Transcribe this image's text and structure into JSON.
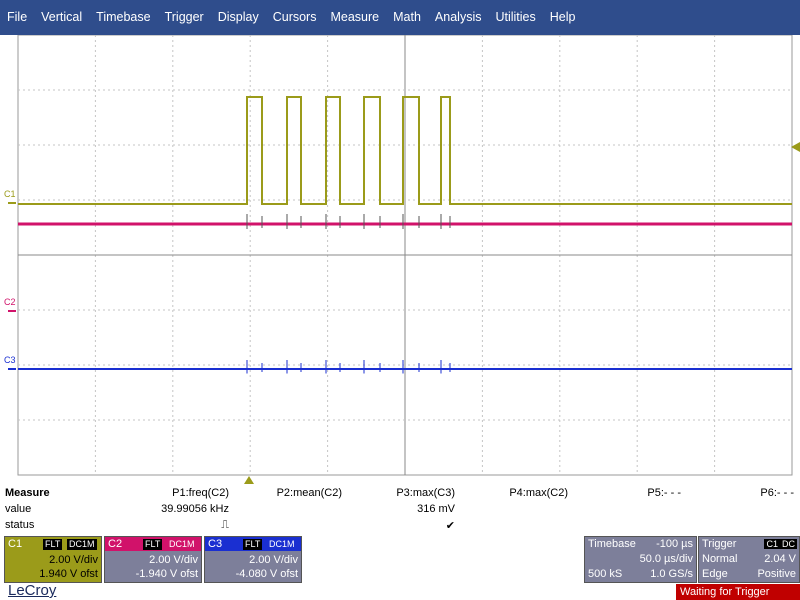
{
  "menu": [
    "File",
    "Vertical",
    "Timebase",
    "Trigger",
    "Display",
    "Cursors",
    "Measure",
    "Math",
    "Analysis",
    "Utilities",
    "Help"
  ],
  "channels": {
    "c1_label": "C1",
    "c2_label": "C2",
    "c3_label": "C3",
    "c1_color": "#9b9b1a",
    "c2_color": "#d1126a",
    "c3_color": "#1a2fd1"
  },
  "measure": {
    "title": "Measure",
    "row_value": "value",
    "row_status": "status",
    "params": [
      {
        "name": "P1:freq(C2)",
        "value": "39.99056 kHz",
        "status": "⎍"
      },
      {
        "name": "P2:mean(C2)",
        "value": "",
        "status": ""
      },
      {
        "name": "P3:max(C3)",
        "value": "316 mV",
        "status": "✔"
      },
      {
        "name": "P4:max(C2)",
        "value": "",
        "status": ""
      },
      {
        "name": "P5:- - -",
        "value": "",
        "status": ""
      },
      {
        "name": "P6:- - -",
        "value": "",
        "status": ""
      }
    ]
  },
  "descriptors": [
    {
      "name": "C1",
      "tag1": "FLT",
      "tag2": "DC1M",
      "vdiv": "2.00 V/div",
      "offset": "1.940 V ofst",
      "color": "#9b9b1a"
    },
    {
      "name": "C2",
      "tag1": "FLT",
      "tag2": "DC1M",
      "vdiv": "2.00 V/div",
      "offset": "-1.940 V ofst",
      "color": "#7d7f9a"
    },
    {
      "name": "C3",
      "tag1": "FLT",
      "tag2": "DC1M",
      "vdiv": "2.00 V/div",
      "offset": "-4.080 V ofst",
      "color": "#7d7f9a"
    }
  ],
  "timebase": {
    "label": "Timebase",
    "delay": "-100 µs",
    "per_div": "50.0 µs/div",
    "samples": "500 kS",
    "rate": "1.0 GS/s"
  },
  "trigger": {
    "label": "Trigger",
    "source": "C1",
    "coupling": "DC",
    "mode": "Normal",
    "level": "2.04 V",
    "type": "Edge",
    "slope": "Positive"
  },
  "status": "Waiting for Trigger",
  "brand": "LeCroy"
}
